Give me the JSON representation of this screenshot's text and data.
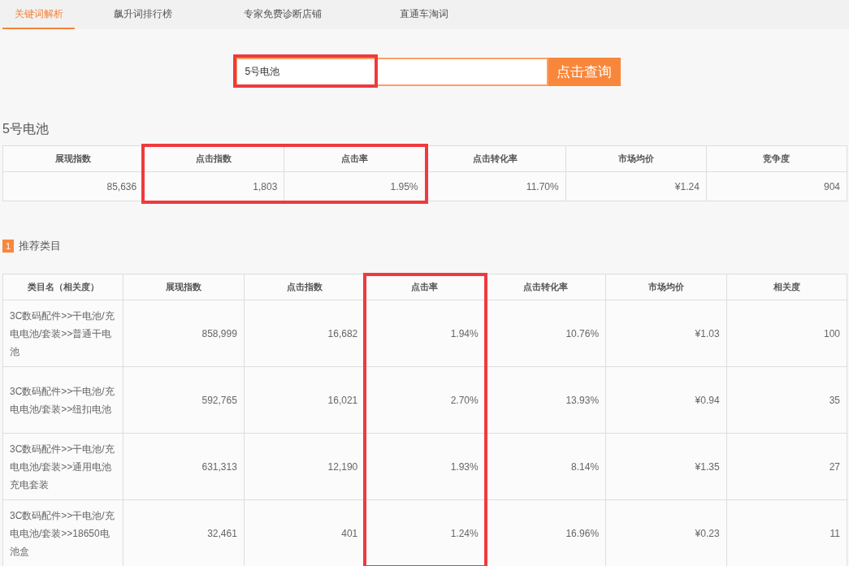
{
  "tabs": [
    {
      "label": "关键词解析",
      "selected": true
    },
    {
      "label": "飙升词排行榜",
      "selected": false
    },
    {
      "label": "专家免费诊断店铺",
      "selected": false
    },
    {
      "label": "直通车淘词",
      "selected": false
    }
  ],
  "search": {
    "value": "5号电池",
    "highlighted": true,
    "button": "点击查询"
  },
  "keyword": "5号电池",
  "summary": {
    "columns": [
      {
        "label": "展现指数",
        "highlighted": false
      },
      {
        "label": "点击指数",
        "highlighted": true
      },
      {
        "label": "点击率",
        "highlighted": true
      },
      {
        "label": "点击转化率",
        "highlighted": false
      },
      {
        "label": "市场均价",
        "highlighted": false
      },
      {
        "label": "竞争度",
        "highlighted": false
      }
    ],
    "values": [
      "85,636",
      "1,803",
      "1.95%",
      "11.70%",
      "¥1.24",
      "904"
    ]
  },
  "section": {
    "number": "1",
    "title": "推荐类目"
  },
  "table": {
    "columns": [
      {
        "label": "类目名（相关度）",
        "highlighted": false
      },
      {
        "label": "展现指数",
        "highlighted": false
      },
      {
        "label": "点击指数",
        "highlighted": false
      },
      {
        "label": "点击率",
        "highlighted": true
      },
      {
        "label": "点击转化率",
        "highlighted": false
      },
      {
        "label": "市场均价",
        "highlighted": false
      },
      {
        "label": "相关度",
        "highlighted": false
      }
    ],
    "rows": [
      [
        "3C数码配件>>干电池/充电电池/套装>>普通干电池",
        "858,999",
        "16,682",
        "1.94%",
        "10.76%",
        "¥1.03",
        "100"
      ],
      [
        "3C数码配件>>干电池/充电电池/套装>>纽扣电池",
        "592,765",
        "16,021",
        "2.70%",
        "13.93%",
        "¥0.94",
        "35"
      ],
      [
        "3C数码配件>>干电池/充电电池/套装>>通用电池充电套装",
        "631,313",
        "12,190",
        "1.93%",
        "8.14%",
        "¥1.35",
        "27"
      ],
      [
        "3C数码配件>>干电池/充电电池/套装>>18650电池盒",
        "32,461",
        "401",
        "1.24%",
        "16.96%",
        "¥0.23",
        "11"
      ]
    ]
  }
}
